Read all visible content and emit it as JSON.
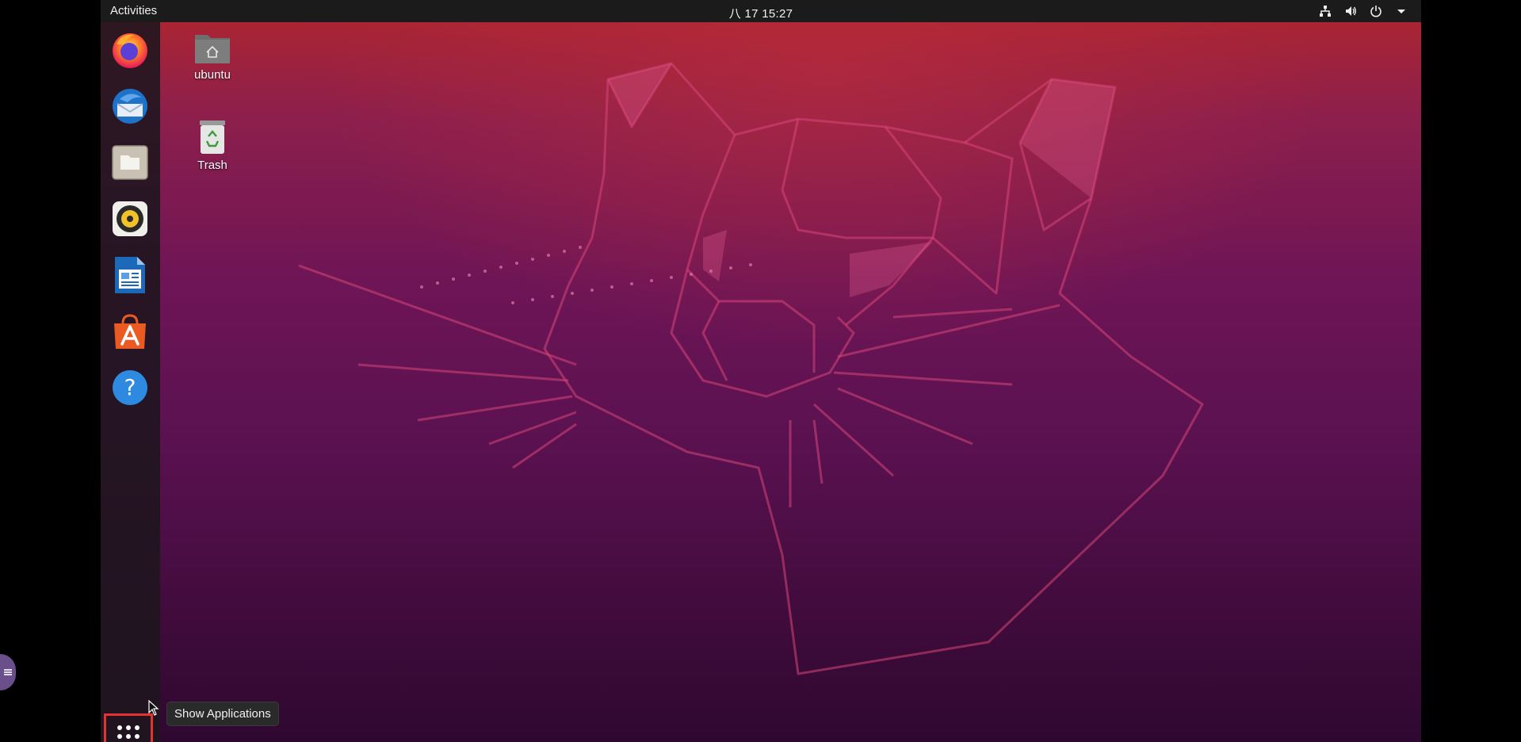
{
  "topbar": {
    "activities": "Activities",
    "clock": "八 17  15:27"
  },
  "tray": {
    "network_icon": "network-icon",
    "volume_icon": "volume-icon",
    "power_icon": "power-icon",
    "menu_icon": "chevron-down-icon"
  },
  "dock": {
    "items": [
      {
        "icon": "firefox-icon"
      },
      {
        "icon": "thunderbird-icon"
      },
      {
        "icon": "files-icon"
      },
      {
        "icon": "rhythmbox-icon"
      },
      {
        "icon": "libreoffice-writer-icon"
      },
      {
        "icon": "ubuntu-software-icon"
      },
      {
        "icon": "help-icon",
        "glyph": "?"
      }
    ],
    "show_apps_tooltip": "Show Applications"
  },
  "desktop": {
    "icons": [
      {
        "label": "ubuntu"
      },
      {
        "label": "Trash"
      }
    ]
  },
  "colors": {
    "topbar": "#1b1b1b",
    "highlight": "#e5322d"
  }
}
